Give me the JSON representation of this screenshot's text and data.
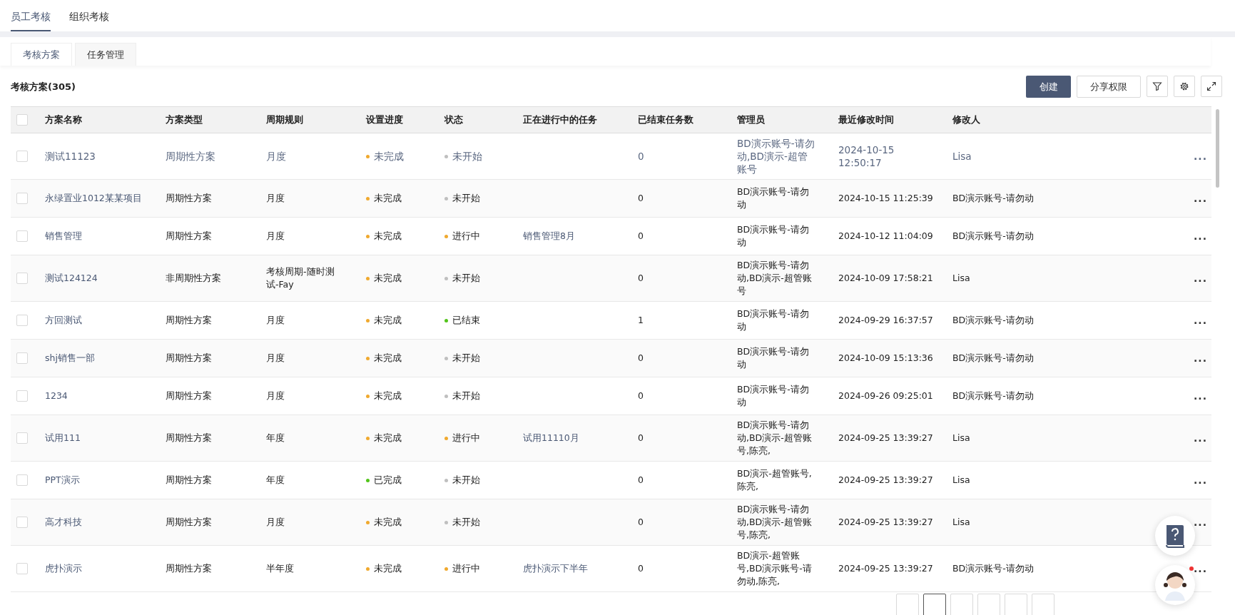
{
  "top_tabs": [
    {
      "label": "员工考核",
      "selected": true
    },
    {
      "label": "组织考核",
      "selected": false
    }
  ],
  "sub_tabs": [
    {
      "label": "考核方案",
      "selected": true
    },
    {
      "label": "任务管理",
      "selected": false
    }
  ],
  "section_title": "考核方案(305)",
  "toolbar": {
    "create": "创建",
    "share": "分享权限"
  },
  "table": {
    "header_checked": false,
    "columns": [
      "方案名称",
      "方案类型",
      "周期规则",
      "设置进度",
      "状态",
      "正在进行中的任务",
      "已结束任务数",
      "管理员",
      "最近修改时间",
      "修改人"
    ],
    "rows": [
      {
        "checked": false,
        "hovered": true,
        "name": "测试11123",
        "type": "周期性方案",
        "cycle": "月度",
        "progress": {
          "text": "未完成",
          "color": "#f0a92e"
        },
        "status": {
          "text": "未开始",
          "color": "#bfbfbf"
        },
        "task": "",
        "ended": "0",
        "admin": "BD演示账号-请勿动,BD演示-超管账号",
        "time": "2024-10-15 12:50:17",
        "modifier": "Lisa",
        "more": "..."
      },
      {
        "checked": false,
        "hovered": false,
        "name": "永绿置业1012某某项目",
        "type": "周期性方案",
        "cycle": "月度",
        "progress": {
          "text": "未完成",
          "color": "#f0a92e"
        },
        "status": {
          "text": "未开始",
          "color": "#bfbfbf"
        },
        "task": "",
        "ended": "0",
        "admin": "BD演示账号-请勿动",
        "time": "2024-10-15 11:25:39",
        "modifier": "BD演示账号-请勿动",
        "more": "..."
      },
      {
        "checked": false,
        "hovered": false,
        "name": "销售管理",
        "type": "周期性方案",
        "cycle": "月度",
        "progress": {
          "text": "未完成",
          "color": "#f0a92e"
        },
        "status": {
          "text": "进行中",
          "color": "#f0a92e"
        },
        "task": "销售管理8月",
        "ended": "0",
        "admin": "BD演示账号-请勿动",
        "time": "2024-10-12 11:04:09",
        "modifier": "BD演示账号-请勿动",
        "more": "..."
      },
      {
        "checked": false,
        "hovered": false,
        "name": "测试124124",
        "type": "非周期性方案",
        "cycle": "考核周期-随时测试-Fay",
        "progress": {
          "text": "未完成",
          "color": "#f0a92e"
        },
        "status": {
          "text": "未开始",
          "color": "#bfbfbf"
        },
        "task": "",
        "ended": "0",
        "admin": "BD演示账号-请勿动,BD演示-超管账号",
        "time": "2024-10-09 17:58:21",
        "modifier": "Lisa",
        "more": "..."
      },
      {
        "checked": false,
        "hovered": false,
        "name": "方回测试",
        "type": "周期性方案",
        "cycle": "月度",
        "progress": {
          "text": "未完成",
          "color": "#f0a92e"
        },
        "status": {
          "text": "已结束",
          "color": "#52c41a"
        },
        "task": "",
        "ended": "1",
        "admin": "BD演示账号-请勿动",
        "time": "2024-09-29 16:37:57",
        "modifier": "BD演示账号-请勿动",
        "more": "..."
      },
      {
        "checked": false,
        "hovered": false,
        "name": "shj销售一部",
        "type": "周期性方案",
        "cycle": "月度",
        "progress": {
          "text": "未完成",
          "color": "#f0a92e"
        },
        "status": {
          "text": "未开始",
          "color": "#bfbfbf"
        },
        "task": "",
        "ended": "0",
        "admin": "BD演示账号-请勿动",
        "time": "2024-10-09 15:13:36",
        "modifier": "BD演示账号-请勿动",
        "more": "..."
      },
      {
        "checked": false,
        "hovered": false,
        "name": "1234",
        "type": "周期性方案",
        "cycle": "月度",
        "progress": {
          "text": "未完成",
          "color": "#f0a92e"
        },
        "status": {
          "text": "未开始",
          "color": "#bfbfbf"
        },
        "task": "",
        "ended": "0",
        "admin": "BD演示账号-请勿动",
        "time": "2024-09-26 09:25:01",
        "modifier": "BD演示账号-请勿动",
        "more": "..."
      },
      {
        "checked": false,
        "hovered": false,
        "name": "试用111",
        "type": "周期性方案",
        "cycle": "年度",
        "progress": {
          "text": "未完成",
          "color": "#f0a92e"
        },
        "status": {
          "text": "进行中",
          "color": "#f0a92e"
        },
        "task": "试用11110月",
        "ended": "0",
        "admin": "BD演示账号-请勿动,BD演示-超管账号,陈亮,",
        "time": "2024-09-25 13:39:27",
        "modifier": "Lisa",
        "more": "..."
      },
      {
        "checked": false,
        "hovered": false,
        "name": "PPT演示",
        "type": "周期性方案",
        "cycle": "年度",
        "progress": {
          "text": "已完成",
          "color": "#52c41a"
        },
        "status": {
          "text": "未开始",
          "color": "#bfbfbf"
        },
        "task": "",
        "ended": "0",
        "admin": "BD演示-超管账号,陈亮,",
        "time": "2024-09-25 13:39:27",
        "modifier": "Lisa",
        "more": "..."
      },
      {
        "checked": false,
        "hovered": false,
        "name": "高才科技",
        "type": "周期性方案",
        "cycle": "月度",
        "progress": {
          "text": "未完成",
          "color": "#f0a92e"
        },
        "status": {
          "text": "未开始",
          "color": "#bfbfbf"
        },
        "task": "",
        "ended": "0",
        "admin": "BD演示账号-请勿动,BD演示-超管账号,陈亮,",
        "time": "2024-09-25 13:39:27",
        "modifier": "Lisa",
        "more": "..."
      },
      {
        "checked": false,
        "hovered": false,
        "name": "虎扑演示",
        "type": "周期性方案",
        "cycle": "半年度",
        "progress": {
          "text": "未完成",
          "color": "#f0a92e"
        },
        "status": {
          "text": "进行中",
          "color": "#f0a92e"
        },
        "task": "虎扑演示下半年",
        "ended": "0",
        "admin": "BD演示-超管账号,BD演示账号-请勿动,陈亮,",
        "time": "2024-09-25 13:39:27",
        "modifier": "BD演示账号-请勿动",
        "more": "..."
      }
    ]
  },
  "floating": {
    "help_unread": false,
    "assistant_unread": true
  }
}
